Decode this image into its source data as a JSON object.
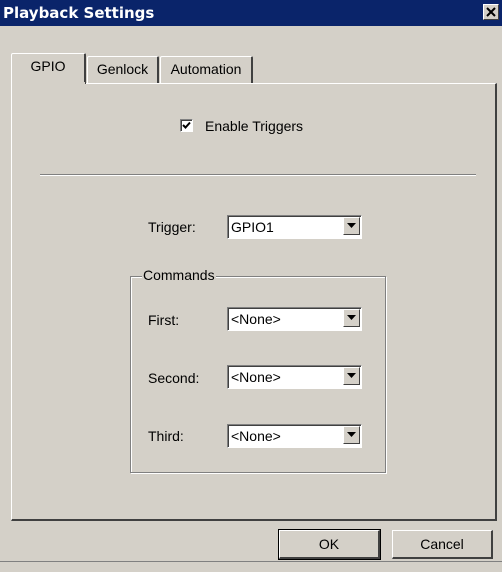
{
  "window": {
    "title": "Playback Settings"
  },
  "tabs": [
    {
      "label": "GPIO",
      "active": true
    },
    {
      "label": "Genlock",
      "active": false
    },
    {
      "label": "Automation",
      "active": false
    }
  ],
  "gpio": {
    "enable_triggers": {
      "label": "Enable Triggers",
      "checked": true
    },
    "trigger": {
      "label": "Trigger:",
      "value": "GPIO1"
    },
    "commands": {
      "legend": "Commands",
      "first": {
        "label": "First:",
        "value": "<None>"
      },
      "second": {
        "label": "Second:",
        "value": "<None>"
      },
      "third": {
        "label": "Third:",
        "value": "<None>"
      }
    }
  },
  "buttons": {
    "ok": "OK",
    "cancel": "Cancel"
  },
  "icons": {
    "close": "close-icon",
    "dropdown": "chevron-down-icon",
    "check": "checkmark-icon"
  },
  "colors": {
    "titlebar": "#0a246a",
    "face": "#d4d0c8"
  }
}
